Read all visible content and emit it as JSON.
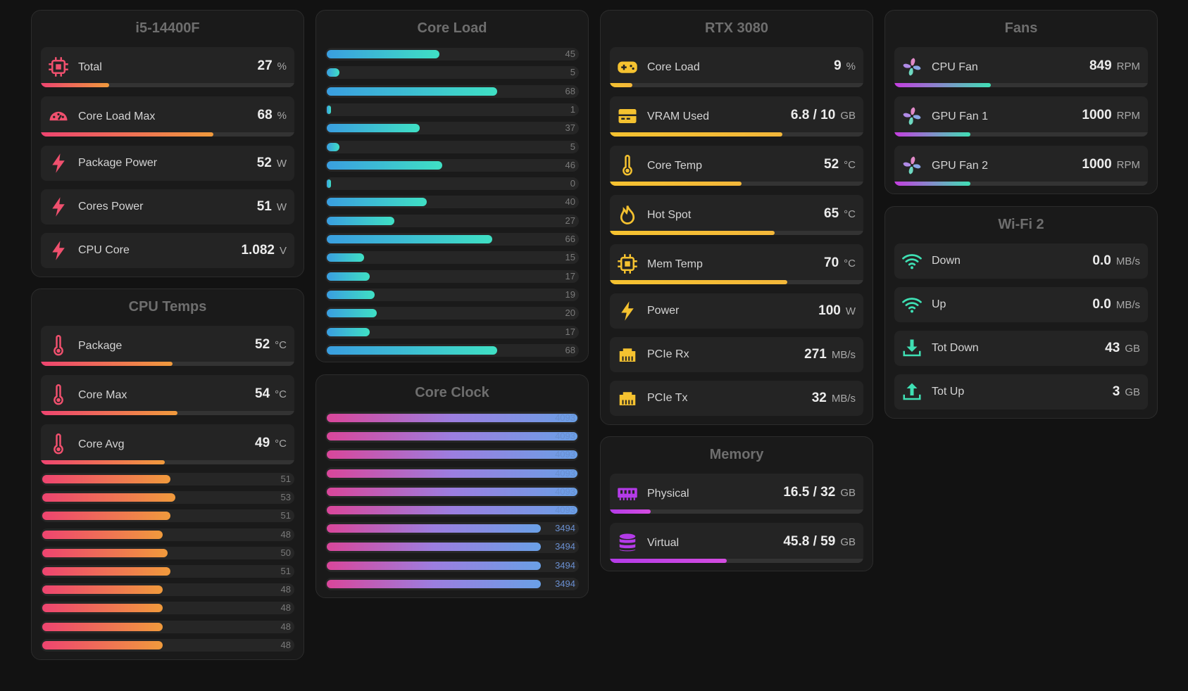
{
  "colors": {
    "cpu_accent": "#f0506e",
    "gpu_accent": "#f5c230",
    "net_accent": "#3fe0b4",
    "mem_accent": "#b43be8",
    "fan_accent": "#9b6ee0"
  },
  "cpu": {
    "title": "i5-14400F",
    "rows": [
      {
        "icon": "cpu-chip-icon",
        "label": "Total",
        "value": "27",
        "unit": "%",
        "percent": 27
      },
      {
        "icon": "gauge-icon",
        "label": "Core Load Max",
        "value": "68",
        "unit": "%",
        "percent": 68
      },
      {
        "icon": "bolt-icon",
        "label": "Package Power",
        "value": "52",
        "unit": "W"
      },
      {
        "icon": "bolt-icon",
        "label": "Cores Power",
        "value": "51",
        "unit": "W"
      },
      {
        "icon": "bolt-icon",
        "label": "CPU Core",
        "value": "1.082",
        "unit": "V"
      }
    ]
  },
  "cpu_temps": {
    "title": "CPU Temps",
    "rows": [
      {
        "icon": "thermometer-icon",
        "label": "Package",
        "value": "52",
        "unit": "°C",
        "percent": 52
      },
      {
        "icon": "thermometer-icon",
        "label": "Core Max",
        "value": "54",
        "unit": "°C",
        "percent": 54
      },
      {
        "icon": "thermometer-icon",
        "label": "Core Avg",
        "value": "49",
        "unit": "°C",
        "percent": 49
      }
    ],
    "cores": [
      51,
      53,
      51,
      48,
      50,
      51,
      48,
      48,
      48,
      48
    ]
  },
  "core_load": {
    "title": "Core Load",
    "values": [
      45,
      5,
      68,
      1,
      37,
      5,
      46,
      0,
      40,
      27,
      66,
      15,
      17,
      19,
      20,
      17,
      68
    ]
  },
  "core_clock": {
    "title": "Core Clock",
    "values": [
      4093,
      4093,
      4093,
      4093,
      4093,
      4093,
      3494,
      3494,
      3494,
      3494
    ],
    "max": 4093
  },
  "gpu": {
    "title": "RTX 3080",
    "rows": [
      {
        "icon": "gamepad-icon",
        "label": "Core Load",
        "value": "9",
        "unit": "%",
        "percent": 9
      },
      {
        "icon": "vram-card-icon",
        "label": "VRAM Used",
        "value": "6.8 / 10",
        "unit": "GB",
        "percent": 68
      },
      {
        "icon": "thermometer-icon",
        "label": "Core Temp",
        "value": "52",
        "unit": "°C",
        "percent": 52
      },
      {
        "icon": "flame-icon",
        "label": "Hot Spot",
        "value": "65",
        "unit": "°C",
        "percent": 65
      },
      {
        "icon": "chip-icon",
        "label": "Mem Temp",
        "value": "70",
        "unit": "°C",
        "percent": 70
      },
      {
        "icon": "bolt-icon",
        "label": "Power",
        "value": "100",
        "unit": "W"
      },
      {
        "icon": "ethernet-port-icon",
        "label": "PCIe Rx",
        "value": "271",
        "unit": "MB/s"
      },
      {
        "icon": "ethernet-port-icon",
        "label": "PCIe Tx",
        "value": "32",
        "unit": "MB/s"
      }
    ]
  },
  "memory": {
    "title": "Memory",
    "rows": [
      {
        "icon": "ram-icon",
        "label": "Physical",
        "value": "16.5 / 32",
        "unit": "GB",
        "percent": 16
      },
      {
        "icon": "database-icon",
        "label": "Virtual",
        "value": "45.8 / 59",
        "unit": "GB",
        "percent": 46
      }
    ]
  },
  "fans": {
    "title": "Fans",
    "rows": [
      {
        "icon": "fan-icon",
        "label": "CPU Fan",
        "value": "849",
        "unit": "RPM",
        "percent": 38
      },
      {
        "icon": "fan-icon",
        "label": "GPU Fan 1",
        "value": "1000",
        "unit": "RPM",
        "percent": 30
      },
      {
        "icon": "fan-icon",
        "label": "GPU Fan 2",
        "value": "1000",
        "unit": "RPM",
        "percent": 30
      }
    ]
  },
  "wifi": {
    "title": "Wi-Fi 2",
    "rows": [
      {
        "icon": "wifi-icon",
        "label": "Down",
        "value": "0.0",
        "unit": "MB/s"
      },
      {
        "icon": "wifi-icon",
        "label": "Up",
        "value": "0.0",
        "unit": "MB/s"
      },
      {
        "icon": "download-icon",
        "label": "Tot Down",
        "value": "43",
        "unit": "GB"
      },
      {
        "icon": "upload-icon",
        "label": "Tot Up",
        "value": "3",
        "unit": "GB"
      }
    ]
  }
}
